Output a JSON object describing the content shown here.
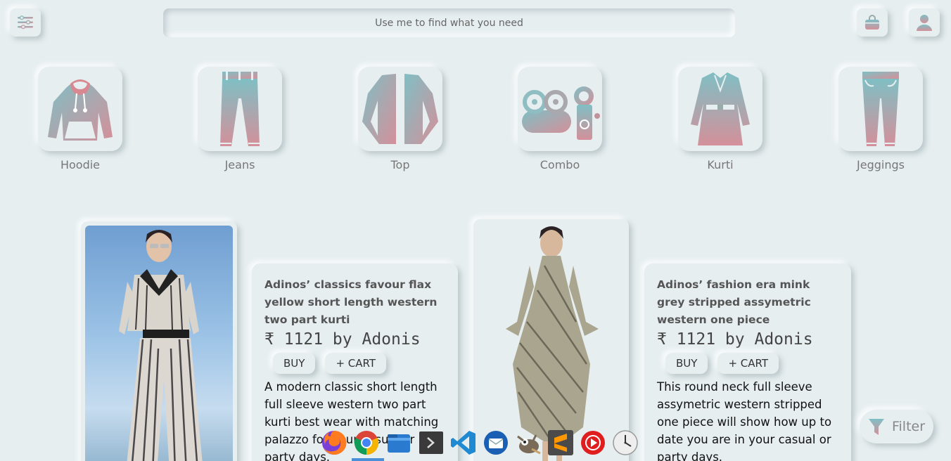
{
  "header": {
    "search_placeholder": "Use me to find what you need",
    "menu_icon": "menu-icon",
    "bag_icon": "shopping-bag-icon",
    "user_icon": "user-icon"
  },
  "categories": [
    {
      "label": "Hoodie",
      "icon": "hoodie-icon"
    },
    {
      "label": "Jeans",
      "icon": "jeans-icon"
    },
    {
      "label": "Top",
      "icon": "top-icon"
    },
    {
      "label": "Combo",
      "icon": "combo-icon"
    },
    {
      "label": "Kurti",
      "icon": "kurti-icon"
    },
    {
      "label": "Jeggings",
      "icon": "jeggings-icon"
    }
  ],
  "products": [
    {
      "title": "Adinos’ classics favour flax yellow short length western two part kurti",
      "price": "₹ 1121 by Adonis",
      "buy_label": "BUY",
      "cart_label": "+ CART",
      "description": "A modern classic short length full sleeve western two part kurti best wear with matching palazzo for your casual or party days."
    },
    {
      "title": "Adinos’ fashion era mink grey stripped assymetric western one piece",
      "price": "₹ 1121 by Adonis",
      "buy_label": "BUY",
      "cart_label": "+ CART",
      "description": "This round neck full sleeve assymetric western stripped one piece will show how up to date you are in your casual or party days."
    }
  ],
  "filter": {
    "label": "Filter",
    "icon": "filter-icon"
  },
  "dock": {
    "items": [
      "firefox-icon",
      "chrome-icon",
      "files-icon",
      "terminal-icon",
      "vscode-icon",
      "thunderbird-icon",
      "gimp-icon",
      "sublime-text-icon",
      "youtube-music-icon",
      "clock-icon"
    ]
  },
  "colors": {
    "background": "#e6eef0",
    "gradient_start": "#7fbfc4",
    "gradient_end": "#d4909a",
    "accent": "#4a90d9"
  }
}
